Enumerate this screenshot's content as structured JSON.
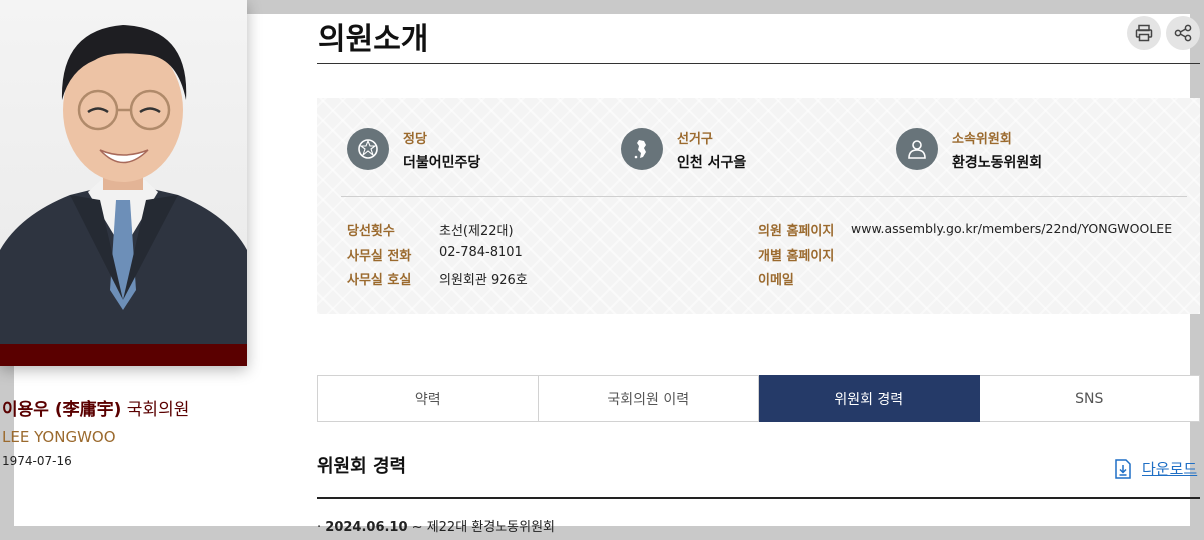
{
  "page": {
    "title": "의원소개",
    "print_icon": "print-icon",
    "share_icon": "share-icon"
  },
  "profile": {
    "name_ko": "이용우 (李庸宇)",
    "name_suffix": "국회의원",
    "name_en": "LEE YONGWOO",
    "birth": "1974-07-16",
    "accent_color": "#5a0000"
  },
  "info": {
    "party": {
      "label": "정당",
      "value": "더불어민주당",
      "icon": "party-emblem-icon"
    },
    "district": {
      "label": "선거구",
      "value": "인천 서구을",
      "icon": "map-icon"
    },
    "committee": {
      "label": "소속위원회",
      "value": "환경노동위원회",
      "icon": "person-icon"
    },
    "details_left": [
      {
        "label": "당선횟수",
        "value": "초선(제22대)"
      },
      {
        "label": "사무실 전화",
        "value": "02-784-8101"
      },
      {
        "label": "사무실 호실",
        "value": "의원회관 926호"
      }
    ],
    "details_right": [
      {
        "label": "의원 홈페이지",
        "value": "www.assembly.go.kr/members/22nd/YONGWOOLEE"
      },
      {
        "label": "개별 홈페이지",
        "value": ""
      },
      {
        "label": "이메일",
        "value": ""
      }
    ]
  },
  "tabs": [
    {
      "label": "약력"
    },
    {
      "label": "국회의원 이력"
    },
    {
      "label": "위원회 경력"
    },
    {
      "label": "SNS"
    }
  ],
  "active_tab": "위원회 경력",
  "section": {
    "title": "위원회 경력",
    "download_label": "다운로드",
    "items": [
      {
        "bullet": "·",
        "date": "2024.06.10",
        "text": " ~ 제22대 환경노동위원회"
      }
    ]
  },
  "colors": {
    "label": "#9b6a2e",
    "tab_active": "#253a68",
    "link": "#1f6fc5"
  }
}
